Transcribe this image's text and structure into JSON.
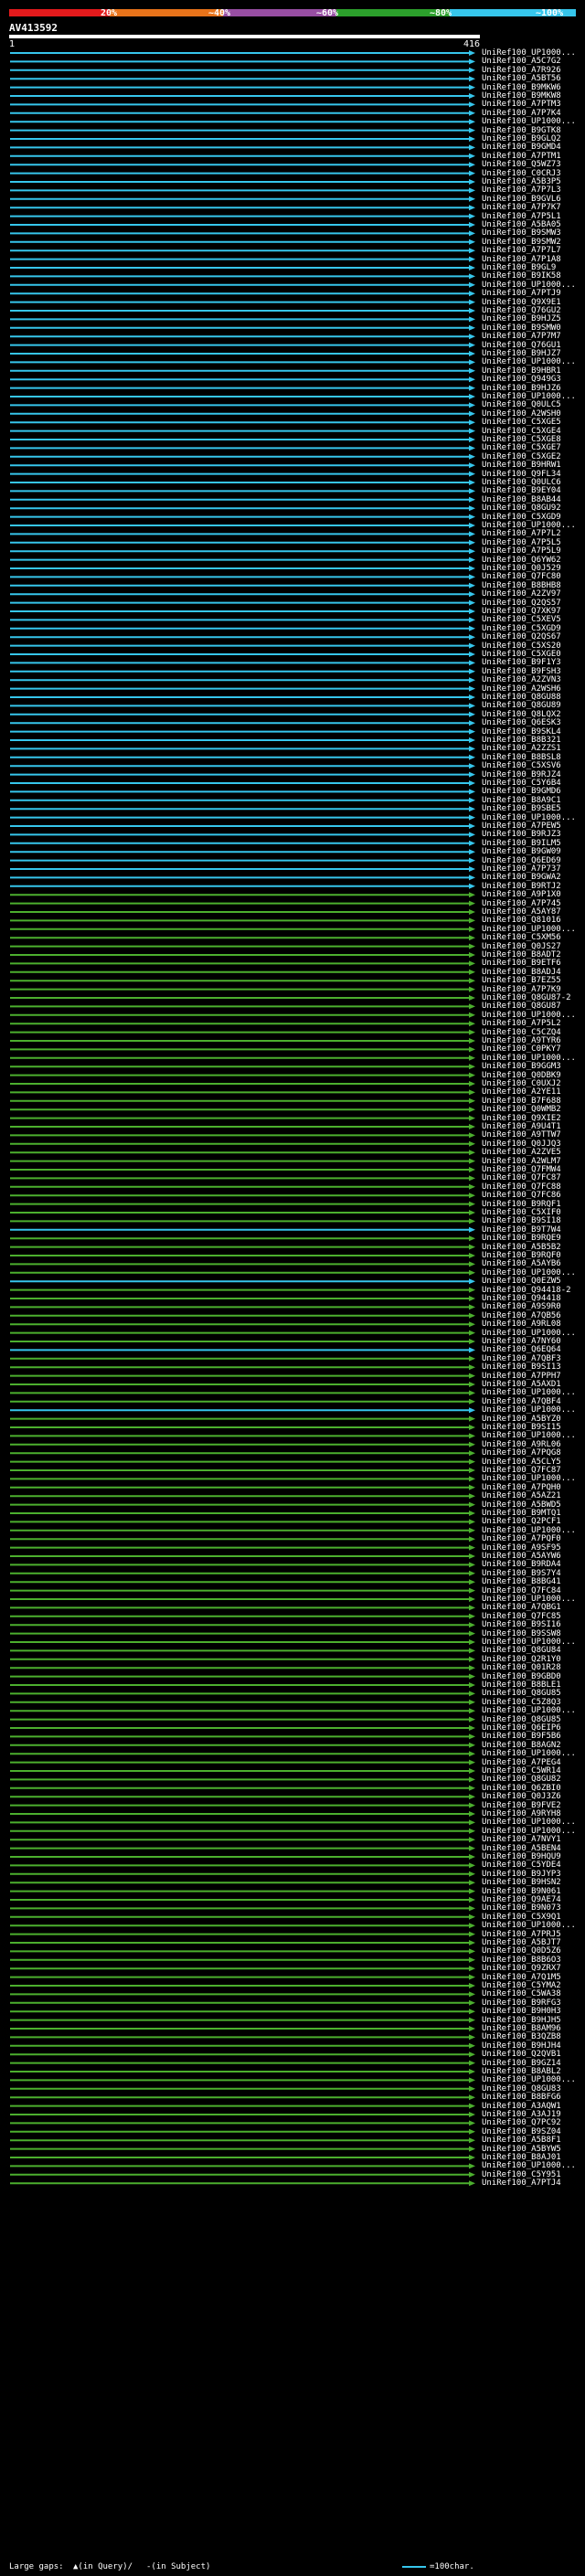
{
  "header": {
    "percent_labels": [
      "20%",
      "~40%",
      "~60%",
      "~80%",
      "~100%"
    ],
    "query_id": "AV413592",
    "query_start": "1",
    "query_end": "416"
  },
  "colors": {
    "bar_segments": [
      "#e41a1c",
      "#e8731a",
      "#984ea3",
      "#2ca02c",
      "#36c6ec"
    ],
    "hit_cyan": "#36c6ec",
    "hit_green": "#4caf2e",
    "gap_fill": "#000000"
  },
  "rows": [
    {
      "label": "UniRef100_UP1000...",
      "color": "cyan"
    },
    {
      "label": "UniRef100_A5C7G2",
      "color": "cyan"
    },
    {
      "label": "UniRef100_A7R926",
      "color": "cyan"
    },
    {
      "label": "UniRef100_A5BT56",
      "color": "cyan"
    },
    {
      "label": "UniRef100_B9MKW6",
      "color": "cyan"
    },
    {
      "label": "UniRef100_B9MKW8",
      "color": "cyan"
    },
    {
      "label": "UniRef100_A7PTM3",
      "color": "cyan"
    },
    {
      "label": "UniRef100_A7P7K4",
      "color": "cyan"
    },
    {
      "label": "UniRef100_UP1000...",
      "color": "cyan"
    },
    {
      "label": "UniRef100_B9GTK8",
      "color": "cyan"
    },
    {
      "label": "UniRef100_B9GLQ2",
      "color": "cyan"
    },
    {
      "label": "UniRef100_B9GMD4",
      "color": "cyan"
    },
    {
      "label": "UniRef100_A7PTM1",
      "color": "cyan"
    },
    {
      "label": "UniRef100_Q5WZ73",
      "color": "cyan"
    },
    {
      "label": "UniRef100_C0CRJ3",
      "color": "cyan"
    },
    {
      "label": "UniRef100_A5B3P5",
      "color": "cyan"
    },
    {
      "label": "UniRef100_A7P7L3",
      "color": "cyan"
    },
    {
      "label": "UniRef100_B9GVL6",
      "color": "cyan"
    },
    {
      "label": "UniRef100_A7P7K7",
      "color": "cyan"
    },
    {
      "label": "UniRef100_A7P5L1",
      "color": "cyan"
    },
    {
      "label": "UniRef100_A5BA05",
      "color": "cyan"
    },
    {
      "label": "UniRef100_B9SMW3",
      "color": "cyan"
    },
    {
      "label": "UniRef100_B9SMW2",
      "color": "cyan"
    },
    {
      "label": "UniRef100_A7P7L7",
      "color": "cyan"
    },
    {
      "label": "UniRef100_A7P1A8",
      "color": "cyan"
    },
    {
      "label": "UniRef100_B9GL9",
      "color": "cyan"
    },
    {
      "label": "UniRef100_B9IK58",
      "color": "cyan"
    },
    {
      "label": "UniRef100_UP1000...",
      "color": "cyan"
    },
    {
      "label": "UniRef100_A7PTJ9",
      "color": "cyan"
    },
    {
      "label": "UniRef100_Q9X9E1",
      "color": "cyan"
    },
    {
      "label": "UniRef100_Q76GU2",
      "color": "cyan"
    },
    {
      "label": "UniRef100_B9HJZ5",
      "color": "cyan"
    },
    {
      "label": "UniRef100_B9SMW0",
      "color": "cyan"
    },
    {
      "label": "UniRef100_A7P7M7",
      "color": "cyan"
    },
    {
      "label": "UniRef100_Q76GU1",
      "color": "cyan"
    },
    {
      "label": "UniRef100_B9HJZ7",
      "color": "cyan"
    },
    {
      "label": "UniRef100_UP1000...",
      "color": "cyan"
    },
    {
      "label": "UniRef100_B9HBR1",
      "color": "cyan"
    },
    {
      "label": "UniRef100_Q949G3",
      "color": "cyan"
    },
    {
      "label": "UniRef100_B9HJZ6",
      "color": "cyan"
    },
    {
      "label": "UniRef100_UP1000...",
      "color": "cyan"
    },
    {
      "label": "UniRef100_Q0ULC5",
      "color": "cyan"
    },
    {
      "label": "UniRef100_A2WSH0",
      "color": "cyan"
    },
    {
      "label": "UniRef100_C5XGE5",
      "color": "cyan"
    },
    {
      "label": "UniRef100_C5XGE4",
      "color": "cyan"
    },
    {
      "label": "UniRef100_C5XGE8",
      "color": "cyan"
    },
    {
      "label": "UniRef100_C5XGE7",
      "color": "cyan"
    },
    {
      "label": "UniRef100_C5XGE2",
      "color": "cyan"
    },
    {
      "label": "UniRef100_B9HRW1",
      "color": "cyan"
    },
    {
      "label": "UniRef100_Q9FL34",
      "color": "cyan"
    },
    {
      "label": "UniRef100_Q0ULC6",
      "color": "cyan"
    },
    {
      "label": "UniRef100_B9EY04",
      "color": "cyan"
    },
    {
      "label": "UniRef100_B8AB44",
      "color": "cyan"
    },
    {
      "label": "UniRef100_Q8GU92",
      "color": "cyan"
    },
    {
      "label": "UniRef100_C5XGD9",
      "color": "cyan"
    },
    {
      "label": "UniRef100_UP1000...",
      "color": "cyan"
    },
    {
      "label": "UniRef100_A7P7L2",
      "color": "cyan"
    },
    {
      "label": "UniRef100_A7P5L5",
      "color": "cyan"
    },
    {
      "label": "UniRef100_A7P5L9",
      "color": "cyan"
    },
    {
      "label": "UniRef100_Q6YW62",
      "color": "cyan"
    },
    {
      "label": "UniRef100_Q0J529",
      "color": "cyan"
    },
    {
      "label": "UniRef100_Q7FC80",
      "color": "cyan"
    },
    {
      "label": "UniRef100_B8BHB8",
      "color": "cyan"
    },
    {
      "label": "UniRef100_A2ZV97",
      "color": "cyan"
    },
    {
      "label": "UniRef100_Q2QS57",
      "color": "cyan"
    },
    {
      "label": "UniRef100_Q7XK97",
      "color": "cyan"
    },
    {
      "label": "UniRef100_C5XEV5",
      "color": "cyan"
    },
    {
      "label": "UniRef100_C5XGD9",
      "color": "cyan"
    },
    {
      "label": "UniRef100_Q2QS67",
      "color": "cyan"
    },
    {
      "label": "UniRef100_C5XS20",
      "color": "cyan"
    },
    {
      "label": "UniRef100_C5XGE0",
      "color": "cyan"
    },
    {
      "label": "UniRef100_B9F1Y3",
      "color": "cyan"
    },
    {
      "label": "UniRef100_B9FSH3",
      "color": "cyan"
    },
    {
      "label": "UniRef100_A2ZVN3",
      "color": "cyan"
    },
    {
      "label": "UniRef100_A2WSH6",
      "color": "cyan"
    },
    {
      "label": "UniRef100_Q8GU88",
      "color": "cyan"
    },
    {
      "label": "UniRef100_Q8GU89",
      "color": "cyan"
    },
    {
      "label": "UniRef100_Q8LQX2",
      "color": "cyan"
    },
    {
      "label": "UniRef100_Q6ESK3",
      "color": "cyan"
    },
    {
      "label": "UniRef100_B9SKL4",
      "color": "cyan"
    },
    {
      "label": "UniRef100_B8B321",
      "color": "cyan"
    },
    {
      "label": "UniRef100_A2ZZS1",
      "color": "cyan"
    },
    {
      "label": "UniRef100_B8BSL8",
      "color": "cyan"
    },
    {
      "label": "UniRef100_C5XSV6",
      "color": "cyan"
    },
    {
      "label": "UniRef100_B9RJZ4",
      "color": "cyan"
    },
    {
      "label": "UniRef100_C5Y6B4",
      "color": "cyan"
    },
    {
      "label": "UniRef100_B9GMD6",
      "color": "cyan"
    },
    {
      "label": "UniRef100_B8A9C1",
      "color": "cyan"
    },
    {
      "label": "UniRef100_B9SBE5",
      "color": "cyan"
    },
    {
      "label": "UniRef100_UP1000...",
      "color": "cyan"
    },
    {
      "label": "UniRef100_A7PEW5",
      "color": "cyan"
    },
    {
      "label": "UniRef100_B9RJZ3",
      "color": "cyan"
    },
    {
      "label": "UniRef100_B9ILM5",
      "color": "cyan"
    },
    {
      "label": "UniRef100_B9GW09",
      "color": "cyan"
    },
    {
      "label": "UniRef100_Q6ED69",
      "color": "cyan"
    },
    {
      "label": "UniRef100_A7P737",
      "color": "cyan"
    },
    {
      "label": "UniRef100_B9GWA2",
      "color": "cyan"
    },
    {
      "label": "UniRef100_B9RTJ2",
      "color": "cyan"
    },
    {
      "label": "UniRef100_A9P1X0",
      "color": "green"
    },
    {
      "label": "UniRef100_A7P745",
      "color": "green"
    },
    {
      "label": "UniRef100_A5AY87",
      "color": "green"
    },
    {
      "label": "UniRef100_Q81016",
      "color": "green"
    },
    {
      "label": "UniRef100_UP1000...",
      "color": "green"
    },
    {
      "label": "UniRef100_C5XM56",
      "color": "green"
    },
    {
      "label": "UniRef100_Q0JS27",
      "color": "green"
    },
    {
      "label": "UniRef100_B8ADT2",
      "color": "green"
    },
    {
      "label": "UniRef100_B9ETF6",
      "color": "green"
    },
    {
      "label": "UniRef100_B8ADJ4",
      "color": "green"
    },
    {
      "label": "UniRef100_B7EZ55",
      "color": "green"
    },
    {
      "label": "UniRef100_A7P7K9",
      "color": "green"
    },
    {
      "label": "UniRef100_Q8GU87-2",
      "color": "green"
    },
    {
      "label": "UniRef100_Q8GU87",
      "color": "green"
    },
    {
      "label": "UniRef100_UP1000...",
      "color": "green"
    },
    {
      "label": "UniRef100_A7P5L2",
      "color": "green"
    },
    {
      "label": "UniRef100_C5CZQ4",
      "color": "green"
    },
    {
      "label": "UniRef100_A9TYR6",
      "color": "green"
    },
    {
      "label": "UniRef100_C0PKY7",
      "color": "green"
    },
    {
      "label": "UniRef100_UP1000...",
      "color": "green"
    },
    {
      "label": "UniRef100_B9GGM3",
      "color": "green"
    },
    {
      "label": "UniRef100_Q0DBK9",
      "color": "green"
    },
    {
      "label": "UniRef100_C0UXJ2",
      "color": "green"
    },
    {
      "label": "UniRef100_A2YE11",
      "color": "green"
    },
    {
      "label": "UniRef100_B7F688",
      "color": "green"
    },
    {
      "label": "UniRef100_Q0WMB2",
      "color": "green"
    },
    {
      "label": "UniRef100_Q9XIE2",
      "color": "green"
    },
    {
      "label": "UniRef100_A9U4T1",
      "color": "green"
    },
    {
      "label": "UniRef100_A9TTW7",
      "color": "green"
    },
    {
      "label": "UniRef100_Q0JJQ3",
      "color": "green"
    },
    {
      "label": "UniRef100_A2ZVE5",
      "color": "green"
    },
    {
      "label": "UniRef100_A2WLM7",
      "color": "green"
    },
    {
      "label": "UniRef100_Q7FMW4",
      "color": "green"
    },
    {
      "label": "UniRef100_Q7FC87",
      "color": "green"
    },
    {
      "label": "UniRef100_Q7FC88",
      "color": "green"
    },
    {
      "label": "UniRef100_Q7FC86",
      "color": "green"
    },
    {
      "label": "UniRef100_B9RQF1",
      "color": "green"
    },
    {
      "label": "UniRef100_C5XIF0",
      "color": "green"
    },
    {
      "label": "UniRef100_B9SI18",
      "color": "green"
    },
    {
      "label": "UniRef100_B9T7W4",
      "color": "cyan"
    },
    {
      "label": "UniRef100_B9RQE9",
      "color": "green"
    },
    {
      "label": "UniRef100_A5B5B2",
      "color": "green"
    },
    {
      "label": "UniRef100_B9RQF0",
      "color": "green"
    },
    {
      "label": "UniRef100_A5AYB6",
      "color": "green"
    },
    {
      "label": "UniRef100_UP1000...",
      "color": "green"
    },
    {
      "label": "UniRef100_Q0EZW5",
      "color": "cyan"
    },
    {
      "label": "UniRef100_Q94418-2",
      "color": "green"
    },
    {
      "label": "UniRef100_Q94418",
      "color": "green"
    },
    {
      "label": "UniRef100_A9S9R0",
      "color": "green"
    },
    {
      "label": "UniRef100_A7QB56",
      "color": "green"
    },
    {
      "label": "UniRef100_A9RL08",
      "color": "green"
    },
    {
      "label": "UniRef100_UP1000...",
      "color": "green"
    },
    {
      "label": "UniRef100_A7NY60",
      "color": "green"
    },
    {
      "label": "UniRef100_Q6EQ64",
      "color": "cyan"
    },
    {
      "label": "UniRef100_A7QBF3",
      "color": "green"
    },
    {
      "label": "UniRef100_B9SI13",
      "color": "green"
    },
    {
      "label": "UniRef100_A7PPH7",
      "color": "green"
    },
    {
      "label": "UniRef100_A5AXD1",
      "color": "green"
    },
    {
      "label": "UniRef100_UP1000...",
      "color": "green"
    },
    {
      "label": "UniRef100_A7QBF4",
      "color": "green"
    },
    {
      "label": "UniRef100_UP1000...",
      "color": "cyan"
    },
    {
      "label": "UniRef100_A5BYZ0",
      "color": "green"
    },
    {
      "label": "UniRef100_B9SI15",
      "color": "green"
    },
    {
      "label": "UniRef100_UP1000...",
      "color": "green"
    },
    {
      "label": "UniRef100_A9RL06",
      "color": "green"
    },
    {
      "label": "UniRef100_A7PQG8",
      "color": "green"
    },
    {
      "label": "UniRef100_A5CLY5",
      "color": "green"
    },
    {
      "label": "UniRef100_Q7FC87",
      "color": "green"
    },
    {
      "label": "UniRef100_UP1000...",
      "color": "green"
    },
    {
      "label": "UniRef100_A7PQH0",
      "color": "green"
    },
    {
      "label": "UniRef100_A5AZ21",
      "color": "green"
    },
    {
      "label": "UniRef100_A5BWD5",
      "color": "green"
    },
    {
      "label": "UniRef100_B9MTQ1",
      "color": "green"
    },
    {
      "label": "UniRef100_Q2PCF1",
      "color": "green"
    },
    {
      "label": "UniRef100_UP1000...",
      "color": "green"
    },
    {
      "label": "UniRef100_A7PQF0",
      "color": "green"
    },
    {
      "label": "UniRef100_A9SF95",
      "color": "green"
    },
    {
      "label": "UniRef100_A5AYW6",
      "color": "green"
    },
    {
      "label": "UniRef100_B9RDA4",
      "color": "green"
    },
    {
      "label": "UniRef100_B9S7Y4",
      "color": "green"
    },
    {
      "label": "UniRef100_B8BG41",
      "color": "green"
    },
    {
      "label": "UniRef100_Q7FC84",
      "color": "green"
    },
    {
      "label": "UniRef100_UP1000...",
      "color": "green"
    },
    {
      "label": "UniRef100_A7QBG1",
      "color": "green"
    },
    {
      "label": "UniRef100_Q7FC85",
      "color": "green"
    },
    {
      "label": "UniRef100_B9SI16",
      "color": "green"
    },
    {
      "label": "UniRef100_B9SSW8",
      "color": "green"
    },
    {
      "label": "UniRef100_UP1000...",
      "color": "green"
    },
    {
      "label": "UniRef100_Q8GU84",
      "color": "green"
    },
    {
      "label": "UniRef100_Q2R1Y0",
      "color": "green"
    },
    {
      "label": "UniRef100_Q01R28",
      "color": "green"
    },
    {
      "label": "UniRef100_B9GBD0",
      "color": "green"
    },
    {
      "label": "UniRef100_B8BLE1",
      "color": "green"
    },
    {
      "label": "UniRef100_Q8GU85",
      "color": "green"
    },
    {
      "label": "UniRef100_C5Z8Q3",
      "color": "green"
    },
    {
      "label": "UniRef100_UP1000...",
      "color": "green"
    },
    {
      "label": "UniRef100_Q8GU85",
      "color": "green"
    },
    {
      "label": "UniRef100_Q6EIP6",
      "color": "green"
    },
    {
      "label": "UniRef100_B9F5B6",
      "color": "green"
    },
    {
      "label": "UniRef100_B8AGN2",
      "color": "green"
    },
    {
      "label": "UniRef100_UP1000...",
      "color": "green"
    },
    {
      "label": "UniRef100_A7PEG4",
      "color": "green"
    },
    {
      "label": "UniRef100_C5WR14",
      "color": "green"
    },
    {
      "label": "UniRef100_Q8GU82",
      "color": "green"
    },
    {
      "label": "UniRef100_Q6ZBI0",
      "color": "green"
    },
    {
      "label": "UniRef100_Q0J3Z6",
      "color": "green"
    },
    {
      "label": "UniRef100_B9FVE2",
      "color": "green"
    },
    {
      "label": "UniRef100_A9RYH8",
      "color": "green"
    },
    {
      "label": "UniRef100_UP1000...",
      "color": "green"
    },
    {
      "label": "UniRef100_UP1000...",
      "color": "green"
    },
    {
      "label": "UniRef100_A7NVY1",
      "color": "green"
    },
    {
      "label": "UniRef100_A5BEN4",
      "color": "green"
    },
    {
      "label": "UniRef100_B9HQU9",
      "color": "green"
    },
    {
      "label": "UniRef100_C5YDE4",
      "color": "green"
    },
    {
      "label": "UniRef100_B9JYP3",
      "color": "green"
    },
    {
      "label": "UniRef100_B9HSN2",
      "color": "green"
    },
    {
      "label": "UniRef100_B9N061",
      "color": "green"
    },
    {
      "label": "UniRef100_Q9AE74",
      "color": "green"
    },
    {
      "label": "UniRef100_B9N073",
      "color": "green"
    },
    {
      "label": "UniRef100_C5X9Q1",
      "color": "green"
    },
    {
      "label": "UniRef100_UP1000...",
      "color": "green"
    },
    {
      "label": "UniRef100_A7PRJ5",
      "color": "green"
    },
    {
      "label": "UniRef100_A5BJT7",
      "color": "green"
    },
    {
      "label": "UniRef100_Q0D5Z6",
      "color": "green"
    },
    {
      "label": "UniRef100_B8B6O3",
      "color": "green"
    },
    {
      "label": "UniRef100_Q9ZRX7",
      "color": "green"
    },
    {
      "label": "UniRef100_A7Q1M5",
      "color": "green"
    },
    {
      "label": "UniRef100_C5YMA2",
      "color": "green"
    },
    {
      "label": "UniRef100_C5WA38",
      "color": "green"
    },
    {
      "label": "UniRef100_B9RFG3",
      "color": "green"
    },
    {
      "label": "UniRef100_B9H0H3",
      "color": "green"
    },
    {
      "label": "UniRef100_B9HJH5",
      "color": "green"
    },
    {
      "label": "UniRef100_B8AM96",
      "color": "green"
    },
    {
      "label": "UniRef100_B3QZB8",
      "color": "green"
    },
    {
      "label": "UniRef100_B9HJH4",
      "color": "green"
    },
    {
      "label": "UniRef100_Q2QVB1",
      "color": "green"
    },
    {
      "label": "UniRef100_B9GZ14",
      "color": "green"
    },
    {
      "label": "UniRef100_B8ABL2",
      "color": "green"
    },
    {
      "label": "UniRef100_UP1000...",
      "color": "green"
    },
    {
      "label": "UniRef100_Q8GU83",
      "color": "green"
    },
    {
      "label": "UniRef100_B8BFG6",
      "color": "green"
    },
    {
      "label": "UniRef100_A3AQW1",
      "color": "green"
    },
    {
      "label": "UniRef100_A3AJ19",
      "color": "green"
    },
    {
      "label": "UniRef100_Q7PC92",
      "color": "green"
    },
    {
      "label": "UniRef100_B9SZ04",
      "color": "green"
    },
    {
      "label": "UniRef100_A5B8F1",
      "color": "green"
    },
    {
      "label": "UniRef100_A5BYW5",
      "color": "green"
    },
    {
      "label": "UniRef100_B8AJ01",
      "color": "green"
    },
    {
      "label": "UniRef100_UP1000...",
      "color": "green"
    },
    {
      "label": "UniRef100_C5Y951",
      "color": "green"
    },
    {
      "label": "UniRef100_A7PTJ4",
      "color": "green"
    }
  ],
  "legend": {
    "large_gaps": "Large gaps:",
    "in_query_marker": "▲(in Query)/",
    "in_subject_marker": "-(in Subject)",
    "scale_label": "=100char."
  }
}
